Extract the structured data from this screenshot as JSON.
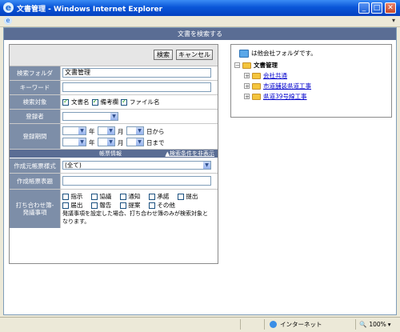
{
  "window": {
    "title": "文書管理 - Windows Internet Explorer",
    "buttons": {
      "minimize": "_",
      "maximize": "□",
      "close": "✕"
    }
  },
  "page": {
    "header": "文書を検索する"
  },
  "toolbar": {
    "search_label": "検索",
    "cancel_label": "キャンセル"
  },
  "form": {
    "search_folder": {
      "label": "検索フォルダ",
      "value": "文書管理"
    },
    "keyword": {
      "label": "キーワード",
      "value": ""
    },
    "search_target": {
      "label": "検索対象",
      "options": [
        {
          "label": "文書名",
          "checked": true
        },
        {
          "label": "備考欄",
          "checked": true
        },
        {
          "label": "ファイル名",
          "checked": true
        }
      ]
    },
    "registrant": {
      "label": "登録者",
      "value": ""
    },
    "period": {
      "label": "登録期間",
      "year_unit": "年",
      "month_unit": "月",
      "from_suffix": "日から",
      "to_suffix": "日まで"
    },
    "report_section": {
      "title": "帳票情報",
      "toggle_label": "▲検索条件を非表示"
    },
    "report_format": {
      "label": "作成元帳票様式",
      "value": "(全て)"
    },
    "report_title": {
      "label": "作成帳票表題",
      "value": ""
    },
    "meeting": {
      "label": "打ち合わせ簿-\n発議事項",
      "options": [
        "指示",
        "協議",
        "通知",
        "承諾",
        "提出",
        "届出",
        "報告",
        "提案",
        "その他"
      ],
      "note": "発議事項を設定した場合、打ち合わせ簿のみが検索対象となります。"
    }
  },
  "tree": {
    "info": "は他会社フォルダです。",
    "root": "文書管理",
    "children": [
      "会社共通",
      "市道舗装県道工事",
      "県道39号線工事"
    ]
  },
  "status": {
    "zone": "インターネット",
    "zoom": "100%"
  },
  "colors": {
    "header_bg": "#5a6d94",
    "label_bg": "#7d8ea8",
    "titlebar": "#0a56d8"
  }
}
